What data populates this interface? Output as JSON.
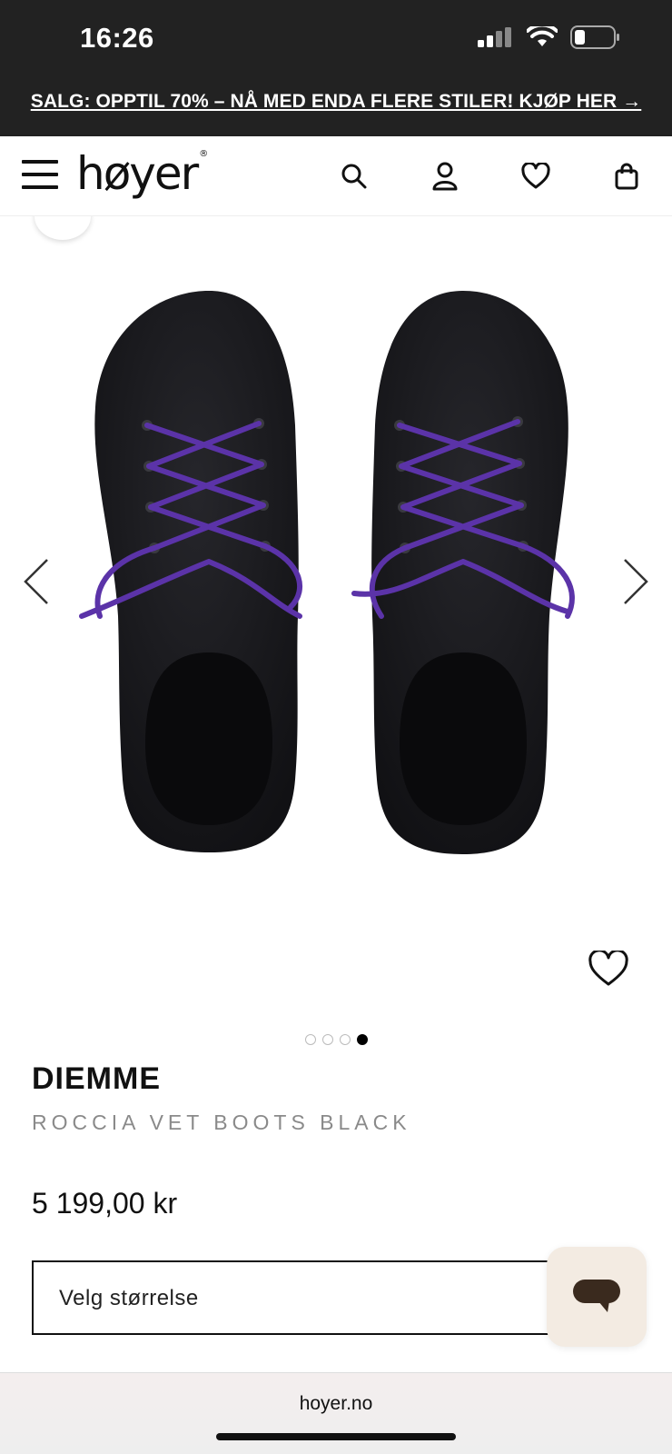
{
  "status": {
    "time": "16:26"
  },
  "promo": {
    "text": "SALG: OPPTIL 70% – NÅ MED ENDA FLERE STILER! KJØP HER →"
  },
  "header": {
    "logo": "høyer",
    "logo_mark": "®"
  },
  "gallery": {
    "image_count": 4,
    "active_index": 4
  },
  "product": {
    "brand": "DIEMME",
    "name": "ROCCIA VET BOOTS BLACK",
    "price": "5 199,00 kr",
    "size_placeholder": "Velg størrelse"
  },
  "browser": {
    "url": "hoyer.no"
  },
  "colors": {
    "topbar": "#222222",
    "lace": "#5b33a8",
    "muted_text": "#8a8a8a",
    "chat_bg": "#f3ebe2"
  }
}
